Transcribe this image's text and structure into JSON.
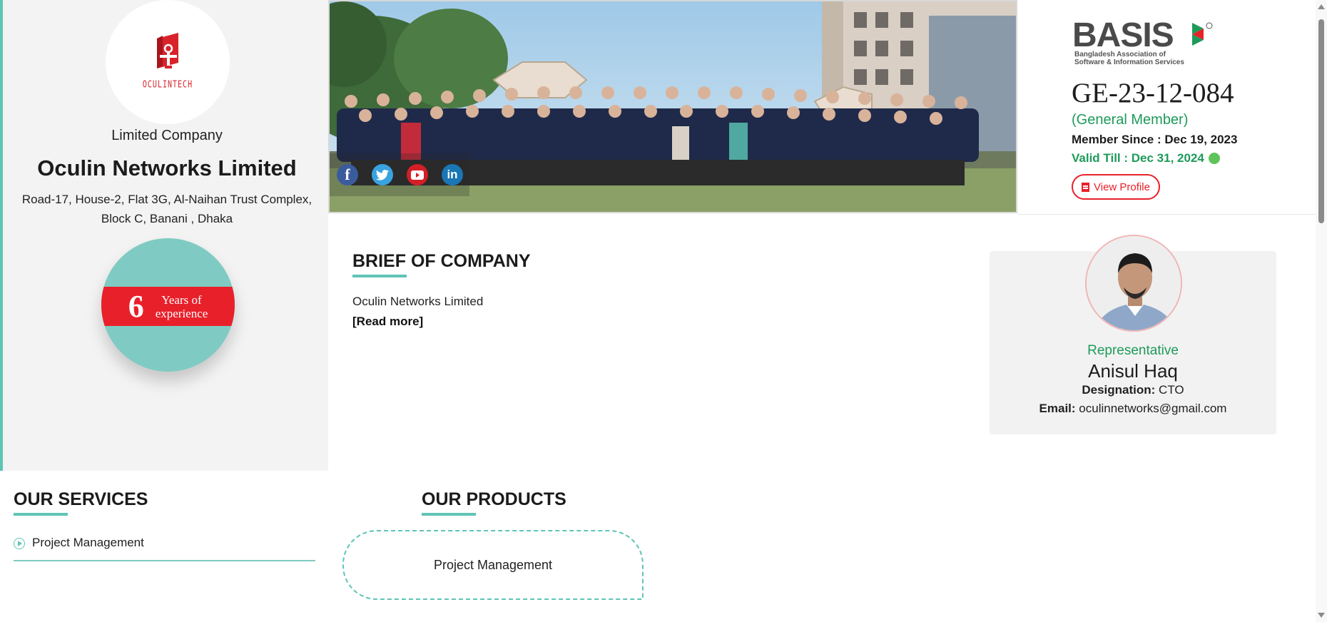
{
  "company": {
    "logo_text": "OCULINTECH",
    "type": "Limited Company",
    "name": "Oculin Networks Limited",
    "address_line1": "Road-17, House-2, Flat 3G, Al-Naihan Trust Complex,",
    "address_line2": "Block C, Banani , Dhaka",
    "experience_years": "6",
    "experience_label_line1": "Years of",
    "experience_label_line2": "experience"
  },
  "social": [
    {
      "name": "facebook-icon",
      "glyph": "f"
    },
    {
      "name": "twitter-icon",
      "glyph": "t"
    },
    {
      "name": "youtube-icon",
      "glyph": "▶"
    },
    {
      "name": "linkedin-icon",
      "glyph": "in"
    }
  ],
  "membership": {
    "org_logo_word": "BASIS",
    "org_logo_subtitle_line1": "Bangladesh Association of",
    "org_logo_subtitle_line2": "Software & Information Services",
    "member_id": "GE-23-12-084",
    "member_type": "(General Member)",
    "member_since": "Member Since : Dec 19, 2023",
    "valid_till": "Valid Till : Dec 31, 2024",
    "view_profile_label": "View Profile"
  },
  "brief": {
    "title": "BRIEF OF COMPANY",
    "text": "Oculin Networks Limited",
    "read_more": "[Read more]"
  },
  "representative": {
    "role": "Representative",
    "name": "Anisul Haq",
    "designation_label": "Designation:",
    "designation": "CTO",
    "email_label": "Email:",
    "email": "oculinnetworks@gmail.com"
  },
  "services": {
    "title": "OUR SERVICES",
    "items": [
      "Project Management"
    ]
  },
  "products": {
    "title": "OUR PRODUCTS",
    "items": [
      "Project Management"
    ]
  },
  "colors": {
    "accent_teal": "#5fc4b6",
    "brand_red": "#e8202a",
    "status_green": "#1e9a5a"
  }
}
